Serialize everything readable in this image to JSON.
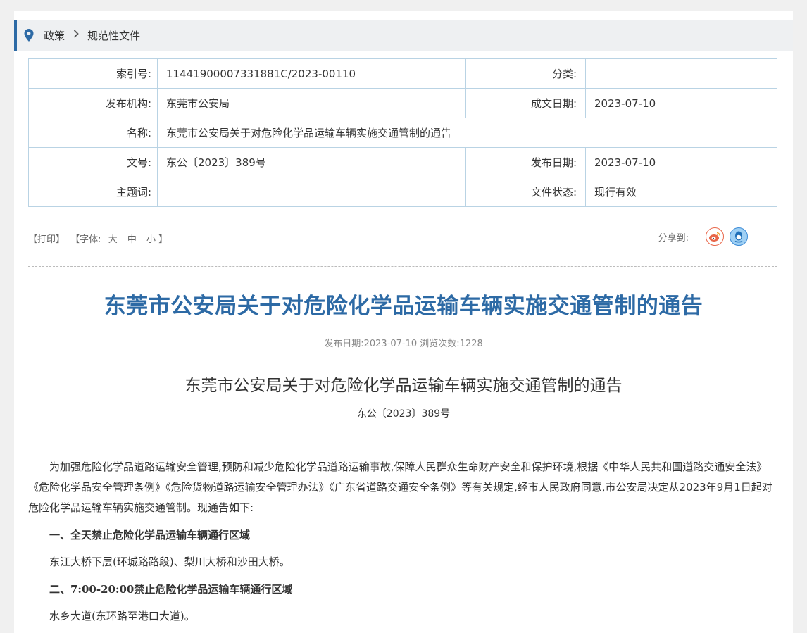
{
  "breadcrumb": {
    "items": [
      "政策",
      "规范性文件"
    ]
  },
  "meta": {
    "index_label": "索引号:",
    "index_value": "11441900007331881C/2023-00110",
    "category_label": "分类:",
    "category_value": "",
    "org_label": "发布机构:",
    "org_value": "东莞市公安局",
    "written_label": "成文日期:",
    "written_value": "2023-07-10",
    "name_label": "名称:",
    "name_value": "东莞市公安局关于对危险化学品运输车辆实施交通管制的通告",
    "docno_label": "文号:",
    "docno_value": "东公〔2023〕389号",
    "pub_label": "发布日期:",
    "pub_value": "2023-07-10",
    "subject_label": "主题词:",
    "subject_value": "",
    "status_label": "文件状态:",
    "status_value": "现行有效"
  },
  "toolbar": {
    "print": "【打印】",
    "font_label": "【字体:",
    "font_large": "大",
    "font_medium": "中",
    "font_small": "小",
    "font_close": "】",
    "share_label": "分享到:"
  },
  "article": {
    "title": "东莞市公安局关于对危险化学品运输车辆实施交通管制的通告",
    "pub_info": "发布日期:2023-07-10 浏览次数:1228",
    "doc_title": "东莞市公安局关于对危险化学品运输车辆实施交通管制的通告",
    "doc_no": "东公〔2023〕389号",
    "para1": "为加强危险化学品道路运输安全管理,预防和减少危险化学品道路运输事故,保障人民群众生命财产安全和保护环境,根据《中华人民共和国道路交通安全法》《危险化学品安全管理条例》《危险货物道路运输安全管理办法》《广东省道路交通安全条例》等有关规定,经市人民政府同意,市公安局决定从2023年9月1日起对危险化学品运输车辆实施交通管制。现通告如下:",
    "heading1": "一、全天禁止危险化学品运输车辆通行区域",
    "line1": "东江大桥下层(环城路路段)、梨川大桥和沙田大桥。",
    "heading2": "二、7:00-20:00禁止危险化学品运输车辆通行区域",
    "line2": "水乡大道(东环路至港口大道)。"
  },
  "colors": {
    "accent": "#2d6aa5",
    "border": "#b9d3e4",
    "weibo": "#e8674a",
    "qq": "#3a8ad6"
  },
  "icons": {
    "location": "map-pin-icon",
    "chevron": "chevron-right-icon",
    "weibo": "weibo-icon",
    "qq": "qq-icon"
  }
}
